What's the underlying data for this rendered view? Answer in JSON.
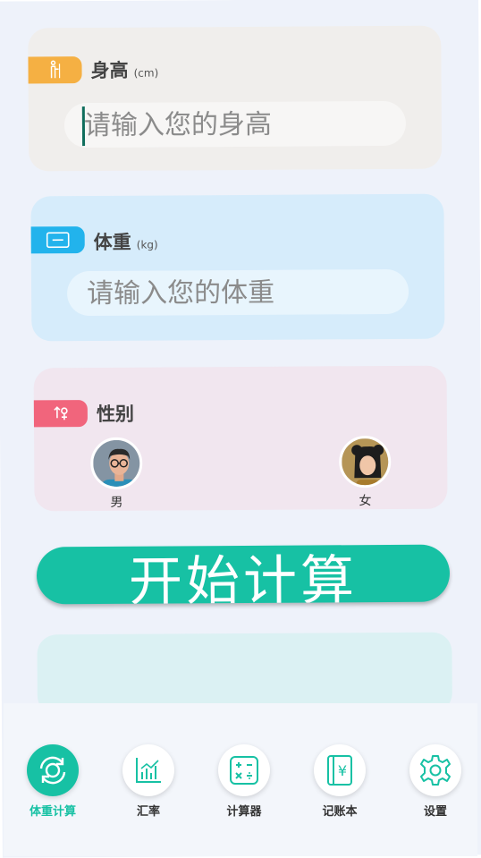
{
  "height_card": {
    "title": "身高",
    "unit": "(cm)",
    "placeholder": "请输入您的身高",
    "icon": "person-height-icon"
  },
  "weight_card": {
    "title": "体重",
    "unit": "(kg)",
    "placeholder": "请输入您的体重",
    "icon": "scale-icon"
  },
  "gender_card": {
    "title": "性别",
    "icon": "gender-icon",
    "options": [
      {
        "label": "男",
        "icon": "male-avatar"
      },
      {
        "label": "女",
        "icon": "female-avatar"
      }
    ]
  },
  "start_button": {
    "label": "开始计算"
  },
  "tabbar": {
    "items": [
      {
        "label": "体重计算",
        "icon": "refresh-cycle-icon",
        "active": true
      },
      {
        "label": "汇率",
        "icon": "chart-icon",
        "active": false
      },
      {
        "label": "计算器",
        "icon": "calculator-icon",
        "active": false
      },
      {
        "label": "记账本",
        "icon": "ledger-icon",
        "active": false
      },
      {
        "label": "设置",
        "icon": "gear-icon",
        "active": false
      }
    ]
  },
  "colors": {
    "accent": "#17c1a4",
    "height_tag": "#f5b043",
    "weight_tag": "#22b3ec",
    "gender_tag": "#f1657c"
  }
}
